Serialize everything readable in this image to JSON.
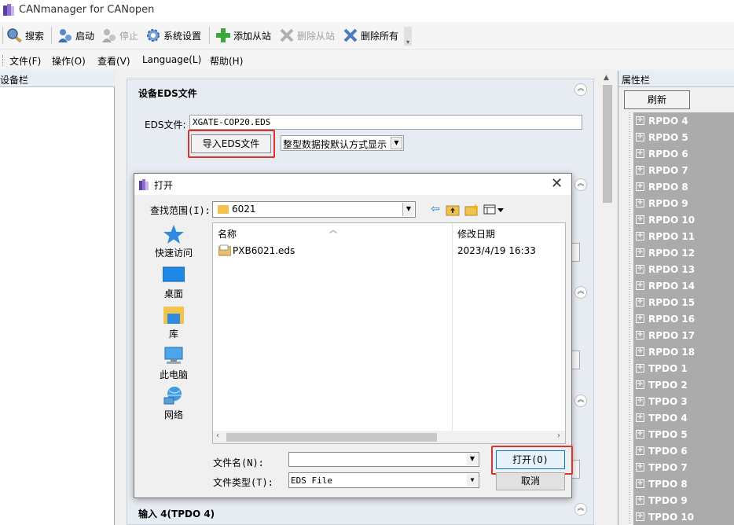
{
  "app": {
    "title": "CANmanager for CANopen"
  },
  "toolbar": {
    "search": "搜索",
    "start": "启动",
    "stop": "停止",
    "settings": "系统设置",
    "add_slave": "添加从站",
    "remove_slave": "删除从站",
    "remove_all": "删除所有"
  },
  "menu": {
    "file": "文件(F)",
    "operate": "操作(O)",
    "view": "查看(V)",
    "language": "Language(L)",
    "help": "帮助(H)"
  },
  "device_panel": {
    "title": "设备栏"
  },
  "config": {
    "eds_section_title": "设备EDS文件",
    "eds_label": "EDS文件:",
    "eds_path": "XGATE-COP20.EDS",
    "import_button": "导入EDS文件",
    "display_mode": "整型数据按默认方式显示",
    "output_section_title": "输入 4(TPDO 4)"
  },
  "property_panel": {
    "title": "属性栏",
    "refresh": "刷新",
    "items": [
      "RPDO 4",
      "RPDO 5",
      "RPDO 6",
      "RPDO 7",
      "RPDO 8",
      "RPDO 9",
      "RPDO 10",
      "RPDO 11",
      "RPDO 12",
      "RPDO 13",
      "RPDO 14",
      "RPDO 15",
      "RPDO 16",
      "RPDO 17",
      "RPDO 18",
      "TPDO 1",
      "TPDO 2",
      "TPDO 3",
      "TPDO 4",
      "TPDO 5",
      "TPDO 6",
      "TPDO 7",
      "TPDO 8",
      "TPDO 9",
      "TPDO 10"
    ]
  },
  "dialog": {
    "title": "打开",
    "look_in_label": "查找范围(I):",
    "look_in_value": "6021",
    "places": [
      "快速访问",
      "桌面",
      "库",
      "此电脑",
      "网络"
    ],
    "columns": {
      "name": "名称",
      "date": "修改日期"
    },
    "files": [
      {
        "name": "PXB6021.eds",
        "date": "2023/4/19 16:33"
      }
    ],
    "filename_label": "文件名(N):",
    "filename_value": "",
    "filetype_label": "文件类型(T):",
    "filetype_value": "EDS File",
    "open_button": "打开(O)",
    "cancel_button": "取消"
  },
  "colors": {
    "highlight": "#e0312b",
    "prop_list_bg": "#ababab",
    "accent": "#0078d7"
  }
}
